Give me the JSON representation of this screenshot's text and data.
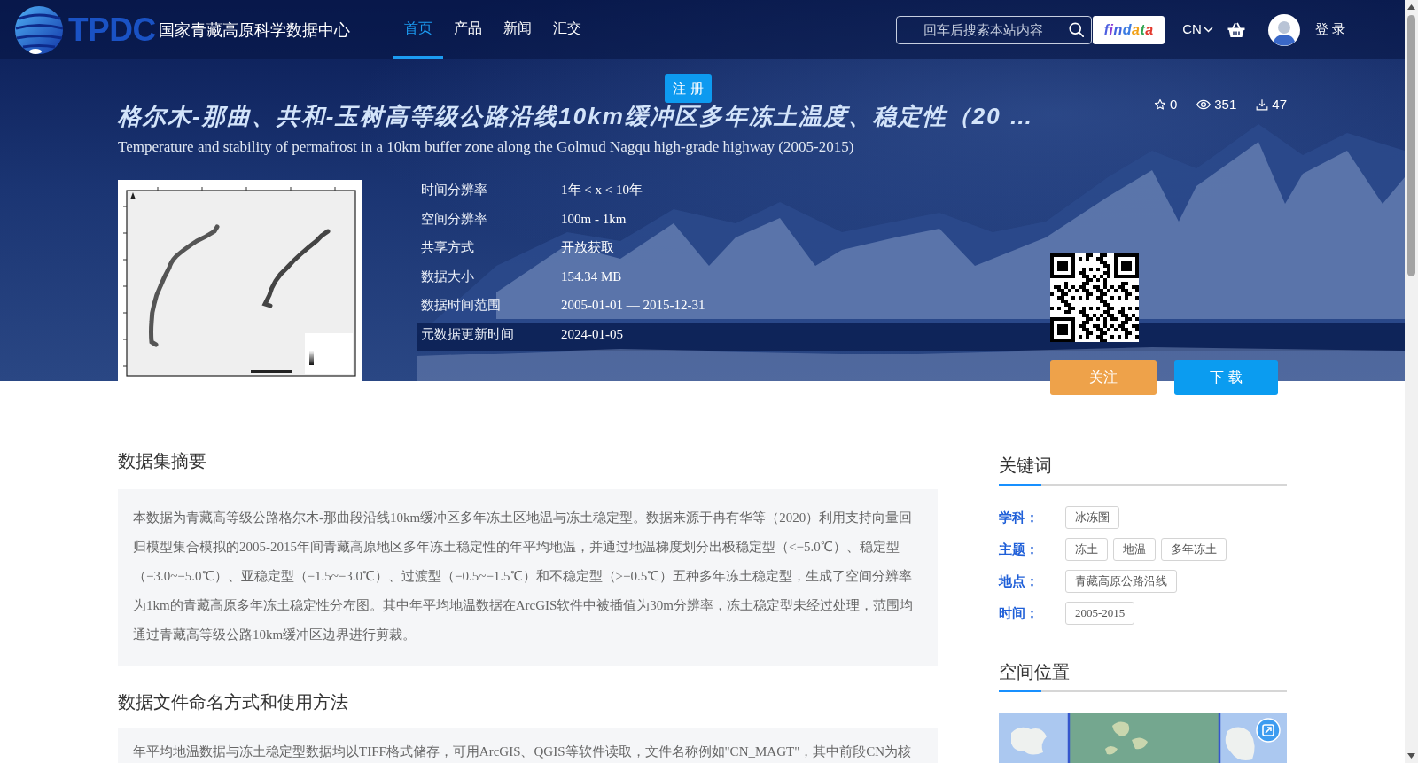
{
  "header": {
    "logo": {
      "abbr": "TPDC",
      "name": "国家青藏高原科学数据中心"
    },
    "nav": [
      {
        "label": "首页",
        "selected": true
      },
      {
        "label": "产品",
        "selected": false
      },
      {
        "label": "新闻",
        "selected": false
      },
      {
        "label": "汇交",
        "selected": false
      }
    ],
    "search": {
      "placeholder": "回车后搜索本站内容"
    },
    "findata": "findata",
    "language": "CN",
    "login": "登 录"
  },
  "register_button": "注 册",
  "dataset": {
    "title": "格尔木-那曲、共和-玉树高等级公路沿线10km缓冲区多年冻土温度、稳定性（20 …",
    "subtitle": "Temperature and stability of permafrost in a 10km buffer zone along the Golmud Nagqu high-grade highway (2005-2015)",
    "stats": [
      {
        "kind": "favorites",
        "value": "0"
      },
      {
        "kind": "views",
        "value": "351"
      },
      {
        "kind": "downloads",
        "value": "47"
      }
    ],
    "metadata": [
      {
        "label": "时间分辨率",
        "value": "1年 < x < 10年"
      },
      {
        "label": "空间分辨率",
        "value": "100m - 1km"
      },
      {
        "label": "共享方式",
        "value": "开放获取"
      },
      {
        "label": "数据大小",
        "value": "154.34 MB"
      },
      {
        "label": "数据时间范围",
        "value": "2005-01-01 — 2015-12-31"
      },
      {
        "label": "元数据更新时间",
        "value": "2024-01-05"
      }
    ],
    "actions": [
      {
        "kind": "follow",
        "label": "关注"
      },
      {
        "kind": "download",
        "label": "下 载"
      }
    ]
  },
  "abstract": {
    "heading": "数据集摘要",
    "text": "本数据为青藏高等级公路格尔木-那曲段沿线10km缓冲区多年冻土区地温与冻土稳定型。数据来源于冉有华等（2020）利用支持向量回归模型集合模拟的2005-2015年间青藏高原地区多年冻土稳定性的年平均地温，并通过地温梯度划分出极稳定型（<−5.0℃）、稳定型（−3.0~−5.0℃）、亚稳定型（−1.5~−3.0℃）、过渡型（−0.5~−1.5℃）和不稳定型（>−0.5℃）五种多年冻土稳定型，生成了空间分辨率为1km的青藏高原多年冻土稳定性分布图。其中年平均地温数据在ArcGIS软件中被插值为30m分辨率，冻土稳定型未经过处理，范围均通过青藏高等级公路10km缓冲区边界进行剪裁。"
  },
  "file_naming": {
    "heading": "数据文件命名方式和使用方法",
    "text": "年平均地温数据与冻土稳定型数据均以TIFF格式储存，可用ArcGIS、QGIS等软件读取，文件名称例如\"CN_MAGT\"，其中前段CN为核"
  },
  "keywords": {
    "heading": "关键词",
    "groups": [
      {
        "label": "学科：",
        "tags": [
          "冰冻圈"
        ]
      },
      {
        "label": "主题：",
        "tags": [
          "冻土",
          "地温",
          "多年冻土"
        ]
      },
      {
        "label": "地点：",
        "tags": [
          "青藏高原公路沿线"
        ]
      },
      {
        "label": "时间：",
        "tags": [
          "2005-2015"
        ]
      }
    ]
  },
  "location": {
    "heading": "空间位置"
  }
}
